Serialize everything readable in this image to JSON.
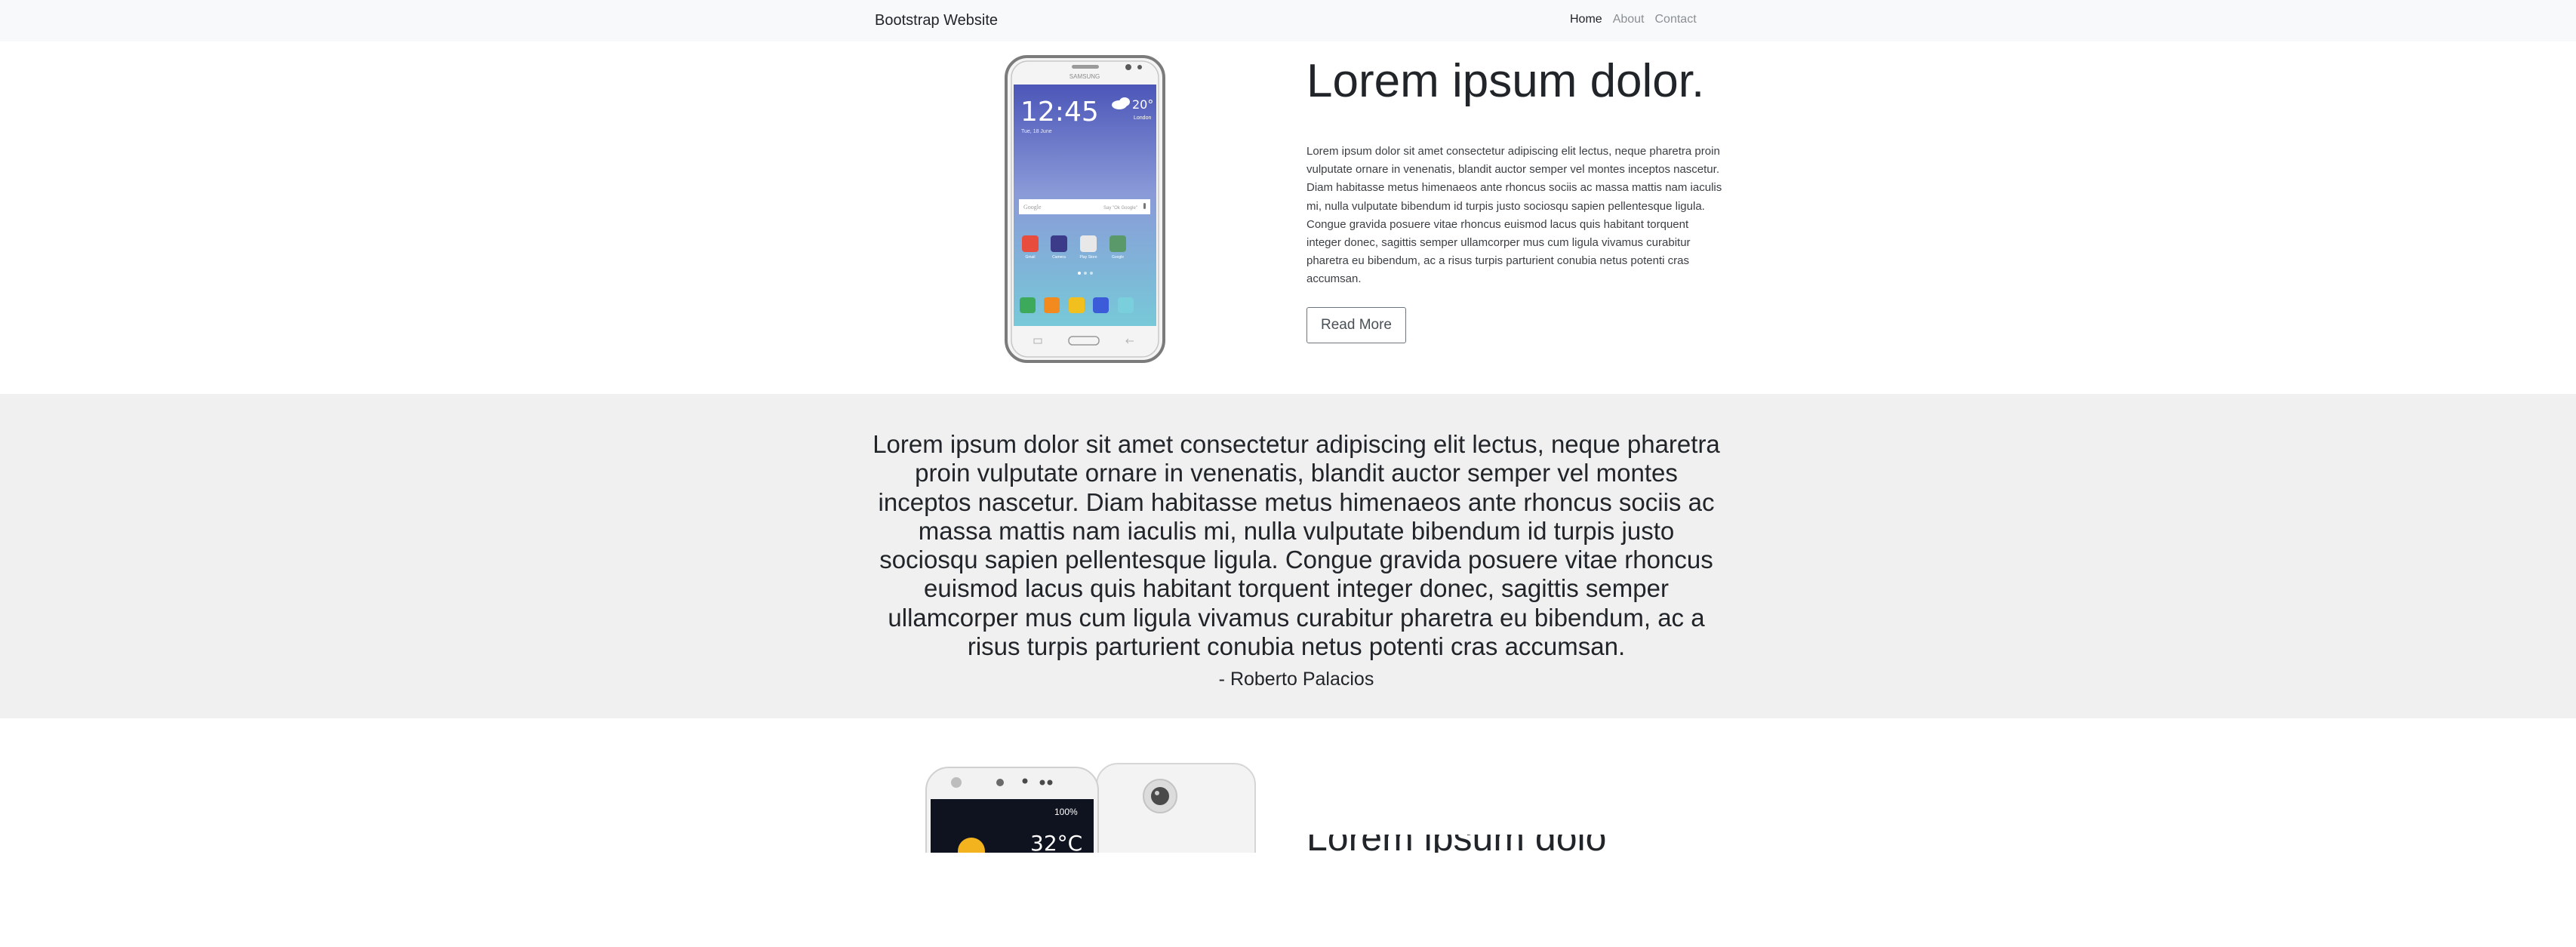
{
  "navbar": {
    "brand": "Bootstrap Website",
    "links": [
      {
        "label": "Home",
        "active": true
      },
      {
        "label": "About",
        "active": false
      },
      {
        "label": "Contact",
        "active": false
      }
    ]
  },
  "hero": {
    "title": "Lorem ipsum dolor.",
    "body": "Lorem ipsum dolor sit amet consectetur adipiscing elit lectus, neque pharetra proin vulputate ornare in venenatis, blandit auctor semper vel montes inceptos nascetur. Diam habitasse metus himenaeos ante rhoncus sociis ac massa mattis nam iaculis mi, nulla vulputate bibendum id turpis justo sociosqu sapien pellentesque ligula. Congue gravida posuere vitae rhoncus euismod lacus quis habitant torquent integer donec, sagittis semper ullamcorper mus cum ligula vivamus curabitur pharetra eu bibendum, ac a risus turpis parturient conubia netus potenti cras accumsan.",
    "button": "Read More",
    "phone_screen": {
      "maker": "SAMSUNG",
      "time": "12:45",
      "date": "Tue, 18 June",
      "temperature": "20°",
      "city": "London",
      "search_placeholder": "Google",
      "search_hint": "Say \"Ok Google\"",
      "apps": [
        "Gmail",
        "Camera",
        "Play Store",
        "Google"
      ]
    }
  },
  "quote": {
    "text": "Lorem ipsum dolor sit amet consectetur adipiscing elit lectus, neque pharetra proin vulputate ornare in venenatis, blandit auctor semper vel montes inceptos nascetur. Diam habitasse metus himenaeos ante rhoncus sociis ac massa mattis nam iaculis mi, nulla vulputate bibendum id turpis justo sociosqu sapien pellentesque ligula. Congue gravida posuere vitae rhoncus euismod lacus quis habitant torquent integer donec, sagittis semper ullamcorper mus cum ligula vivamus curabitur pharetra eu bibendum, ac a risus turpis parturient conubia netus potenti cras accumsan.",
    "author": "- Roberto Palacios"
  },
  "section2": {
    "phone_screen": {
      "battery": "100%",
      "temperature": "32°C"
    },
    "heading": "Lorem ipsum dolor sit amet."
  },
  "colors": {
    "navbar_bg": "#f8f9fa",
    "band_bg": "#f0f0f0",
    "text": "#212529",
    "muted": "#8a8f94"
  }
}
